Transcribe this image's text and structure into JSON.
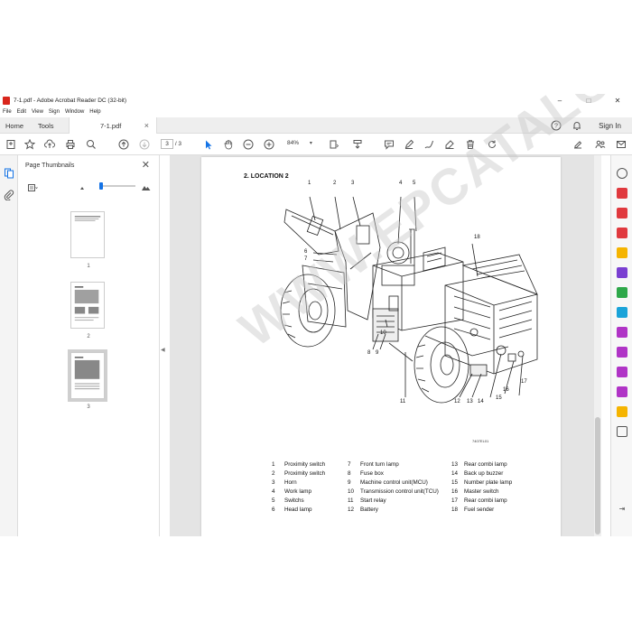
{
  "window": {
    "title": "7-1.pdf - Adobe Acrobat Reader DC (32-bit)",
    "minimize": "–",
    "maximize": "□",
    "close": "✕"
  },
  "menu": [
    "File",
    "Edit",
    "View",
    "Sign",
    "Window",
    "Help"
  ],
  "tabs": {
    "home": "Home",
    "tools": "Tools",
    "document": "7-1.pdf",
    "doc_close": "×"
  },
  "account": {
    "signin": "Sign In"
  },
  "toolbar": {
    "page_current": "3",
    "page_total": "/ 3",
    "zoom": "84%"
  },
  "thumbnails": {
    "title": "Page Thumbnails",
    "pages": [
      "1",
      "2",
      "3"
    ],
    "selected": 3
  },
  "document": {
    "heading": "2. LOCATION 2",
    "figure_ref": "7407EL01",
    "watermark": "WWW.EPCATALOGS.COM",
    "callouts": [
      "1",
      "2",
      "3",
      "4",
      "5",
      "6",
      "7",
      "8",
      "9",
      "10",
      "11",
      "12",
      "13",
      "14",
      "15",
      "16",
      "17",
      "18"
    ],
    "legend": [
      {
        "n": "1",
        "label": "Proximity switch"
      },
      {
        "n": "2",
        "label": "Proximity switch"
      },
      {
        "n": "3",
        "label": "Horn"
      },
      {
        "n": "4",
        "label": "Work lamp"
      },
      {
        "n": "5",
        "label": "Switchs"
      },
      {
        "n": "6",
        "label": "Head lamp"
      },
      {
        "n": "7",
        "label": "Front turn lamp"
      },
      {
        "n": "8",
        "label": "Fuse box"
      },
      {
        "n": "9",
        "label": "Machine control unit(MCU)"
      },
      {
        "n": "10",
        "label": "Transmission control unit(TCU)"
      },
      {
        "n": "11",
        "label": "Start relay"
      },
      {
        "n": "12",
        "label": "Battery"
      },
      {
        "n": "13",
        "label": "Rear combi lamp"
      },
      {
        "n": "14",
        "label": "Back up buzzer"
      },
      {
        "n": "15",
        "label": "Number plate lamp"
      },
      {
        "n": "16",
        "label": "Master switch"
      },
      {
        "n": "17",
        "label": "Rear combi lamp"
      },
      {
        "n": "18",
        "label": "Fuel sender"
      }
    ]
  },
  "colors": {
    "accent": "#1473e6",
    "pdf_red": "#d9261c",
    "background": "#e4e4e4"
  }
}
